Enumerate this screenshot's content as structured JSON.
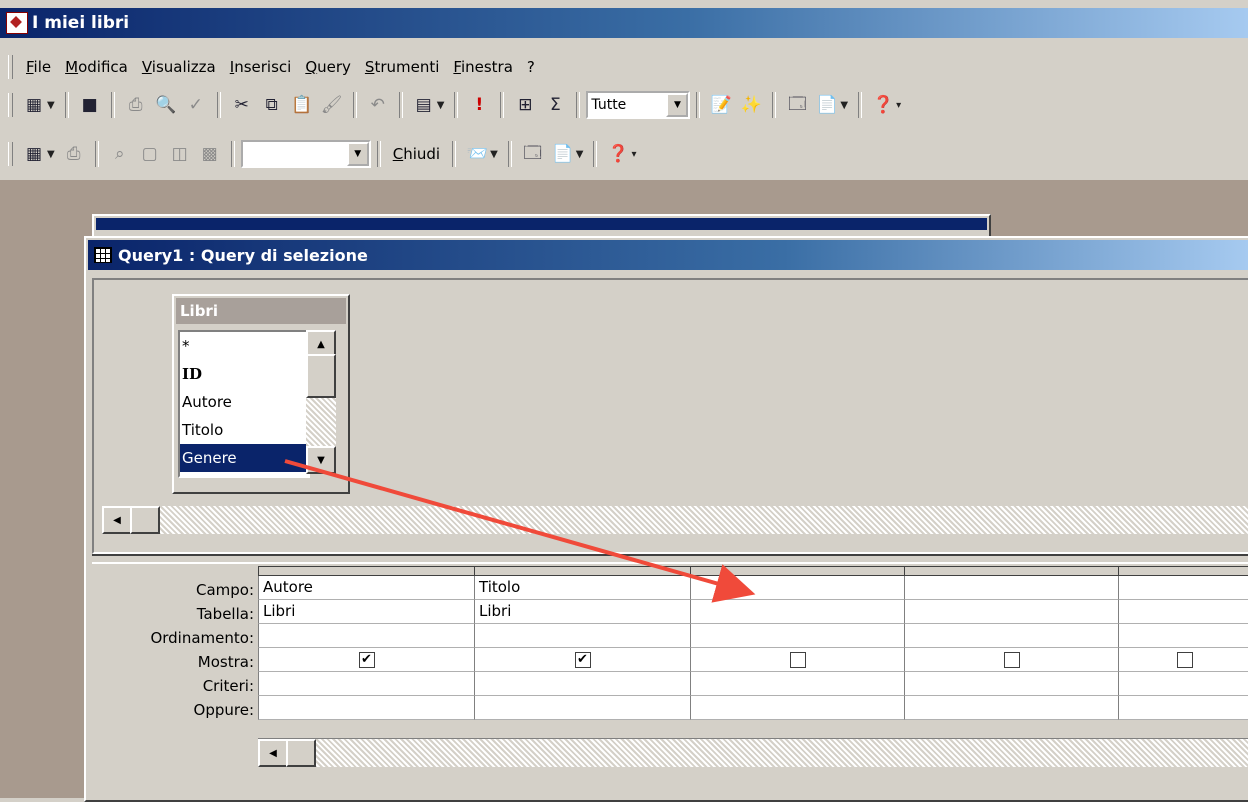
{
  "app": {
    "title": "I miei libri"
  },
  "menu": [
    "File",
    "Modifica",
    "Visualizza",
    "Inserisci",
    "Query",
    "Strumenti",
    "Finestra",
    "?"
  ],
  "toolbar1": {
    "icons": [
      "datasheet-view-icon",
      "save-icon",
      "print-icon",
      "print-preview-icon",
      "spelling-icon",
      "cut-icon",
      "copy-icon",
      "paste-icon",
      "format-painter-icon",
      "undo-icon",
      "query-type-icon",
      "run-icon",
      "show-table-icon",
      "totals-icon",
      "properties-icon",
      "build-icon",
      "database-window-icon",
      "new-object-icon",
      "help-icon"
    ],
    "top_values": "Tutte"
  },
  "toolbar2": {
    "close_label": "Chiudi",
    "combo_value": ""
  },
  "query_window": {
    "title": "Query1 : Query di selezione"
  },
  "table": {
    "name": "Libri",
    "fields": [
      "*",
      "ID",
      "Autore",
      "Titolo",
      "Genere"
    ],
    "selected": "Genere"
  },
  "grid": {
    "row_labels": [
      "Campo:",
      "Tabella:",
      "Ordinamento:",
      "Mostra:",
      "Criteri:",
      "Oppure:"
    ],
    "columns": [
      {
        "campo": "Autore",
        "tabella": "Libri",
        "ordinamento": "",
        "mostra": true,
        "criteri": "",
        "oppure": ""
      },
      {
        "campo": "Titolo",
        "tabella": "Libri",
        "ordinamento": "",
        "mostra": true,
        "criteri": "",
        "oppure": ""
      },
      {
        "campo": "",
        "tabella": "",
        "ordinamento": "",
        "mostra": false,
        "criteri": "",
        "oppure": ""
      },
      {
        "campo": "",
        "tabella": "",
        "ordinamento": "",
        "mostra": false,
        "criteri": "",
        "oppure": ""
      },
      {
        "campo": "",
        "tabella": "",
        "ordinamento": "",
        "mostra": false,
        "criteri": "",
        "oppure": ""
      }
    ]
  },
  "colors": {
    "titlebar": "#0a246a",
    "selection": "#0a246a",
    "annotation_arrow": "#f04a3a"
  }
}
